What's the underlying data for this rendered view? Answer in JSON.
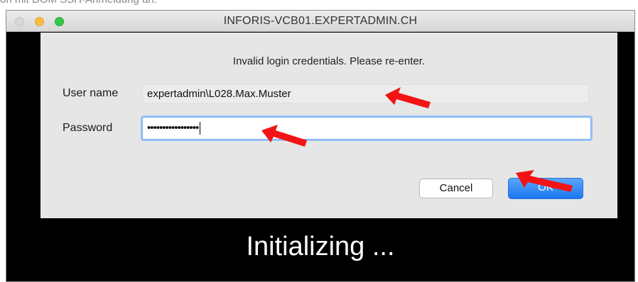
{
  "top_strip": {
    "text": "on mit DOM SSH-Anmeldung an."
  },
  "window": {
    "title": "INFORIS-VCB01.EXPERTADMIN.CH",
    "controls": [
      "close",
      "minimize",
      "zoom"
    ]
  },
  "dialog": {
    "message": "Invalid login credentials. Please re-enter.",
    "username_label": "User name",
    "username_value": "expertadmin\\L028.Max.Muster",
    "password_label": "Password",
    "password_mask": "•••••••••••••••••",
    "cancel_label": "Cancel",
    "ok_label": "OK"
  },
  "status": {
    "text": "Initializing ..."
  },
  "colors": {
    "annotation_arrow": "#f21414",
    "ok_button": "#1a77f0",
    "focus_ring": "#9cc3f5"
  },
  "icons": {
    "arrow": "red-arrow-icon"
  }
}
